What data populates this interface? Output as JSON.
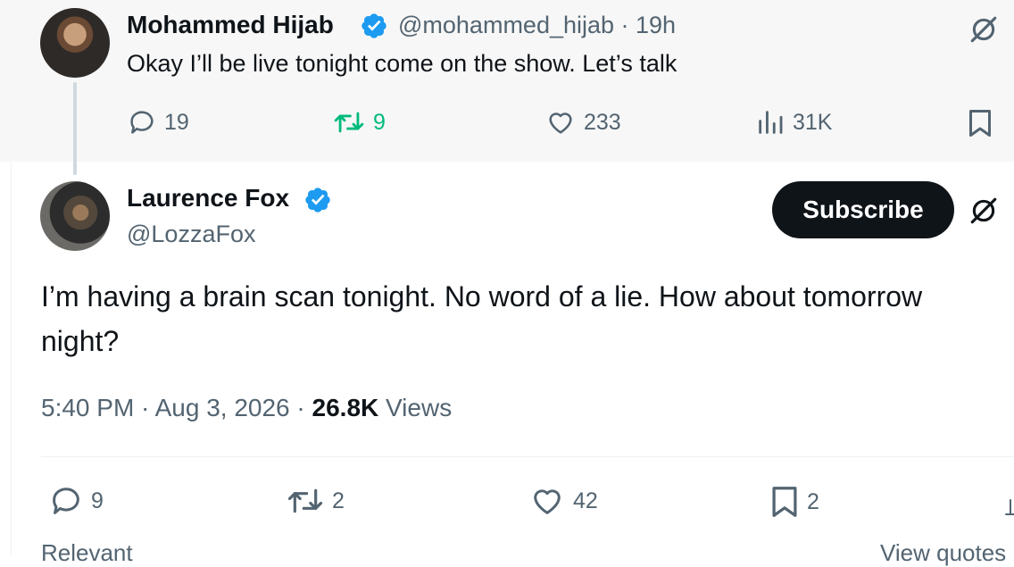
{
  "parent_tweet": {
    "name": "Mohammed Hijab",
    "handle_time": "@mohammed_hijab · 19h",
    "text": "Okay I’ll be live tonight come on the show. Let’s talk",
    "replies": "19",
    "retweets": "9",
    "likes": "233",
    "views": "31K",
    "icons": [
      "grok-icon",
      "reply-icon",
      "retweet-icon",
      "like-icon",
      "views-icon",
      "bookmark-icon",
      "verified-badge-icon"
    ]
  },
  "main_tweet": {
    "name": "Laurence Fox",
    "handle": "@LozzaFox",
    "subscribe_label": "Subscribe",
    "text_line1": "I’m having a brain scan tonight. No word of a lie. How about tomorrow",
    "text_line2": "night?",
    "time_date": "5:40 PM · Aug 3, 2026 · ",
    "views_count": "26.8K",
    "views_label": " Views",
    "replies": "9",
    "retweets": "2",
    "likes": "42",
    "bookmarks": "2",
    "icons": [
      "grok-icon",
      "reply-icon",
      "retweet-icon",
      "like-icon",
      "bookmark-icon",
      "verified-badge-icon"
    ]
  },
  "footer": {
    "left_cut": "Relevant",
    "right_cut": "View quotes"
  },
  "colors": {
    "text": "#0f1419",
    "secondary": "#536471",
    "verified": "#1d9bf0",
    "retweet_active": "#00ba7c",
    "parent_bg": "#f7f7f7",
    "button_bg": "#0f1419"
  }
}
